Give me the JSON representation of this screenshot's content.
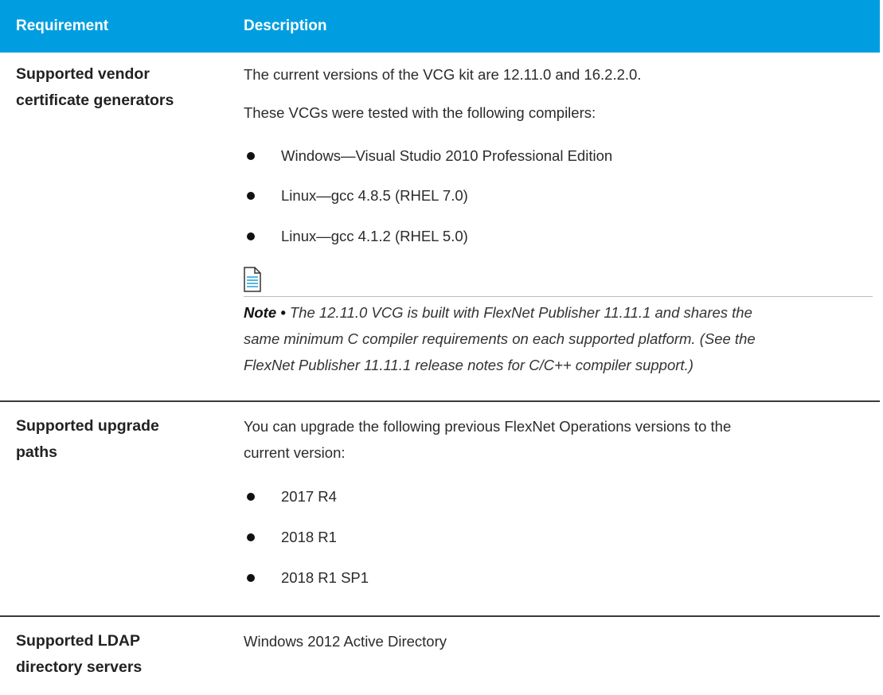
{
  "header": {
    "requirement": "Requirement",
    "description": "Description"
  },
  "rows": [
    {
      "requirement_lines": [
        "Supported vendor",
        "certificate generators"
      ],
      "intro": "The current versions of the VCG kit are 12.11.0 and 16.2.2.0.",
      "lead": "These VCGs were tested with the following compilers:",
      "bullets": [
        "Windows—Visual Studio 2010 Professional Edition",
        "Linux—gcc 4.8.5 (RHEL 7.0)",
        "Linux—gcc 4.1.2 (RHEL 5.0)"
      ],
      "note": {
        "icon": "note-document-icon",
        "label": "Note •",
        "lines": [
          "The 12.11.0 VCG is built with FlexNet Publisher 11.11.1 and shares the",
          "same minimum C compiler requirements on each supported platform. (See the",
          "FlexNet Publisher 11.11.1 release notes for C/C++ compiler support.)"
        ]
      }
    },
    {
      "requirement_lines": [
        "Supported upgrade",
        "paths"
      ],
      "intro_lines": [
        "You can upgrade the following previous FlexNet Operations versions to the",
        "current version:"
      ],
      "bullets": [
        "2017 R4",
        "2018 R1",
        "2018 R1 SP1"
      ]
    },
    {
      "requirement_lines": [
        "Supported LDAP",
        "directory servers"
      ],
      "intro": "Windows 2012 Active Directory"
    }
  ],
  "colors": {
    "header_bg": "#009ee0",
    "header_text": "#ffffff",
    "icon_accent": "#2aa7de"
  }
}
